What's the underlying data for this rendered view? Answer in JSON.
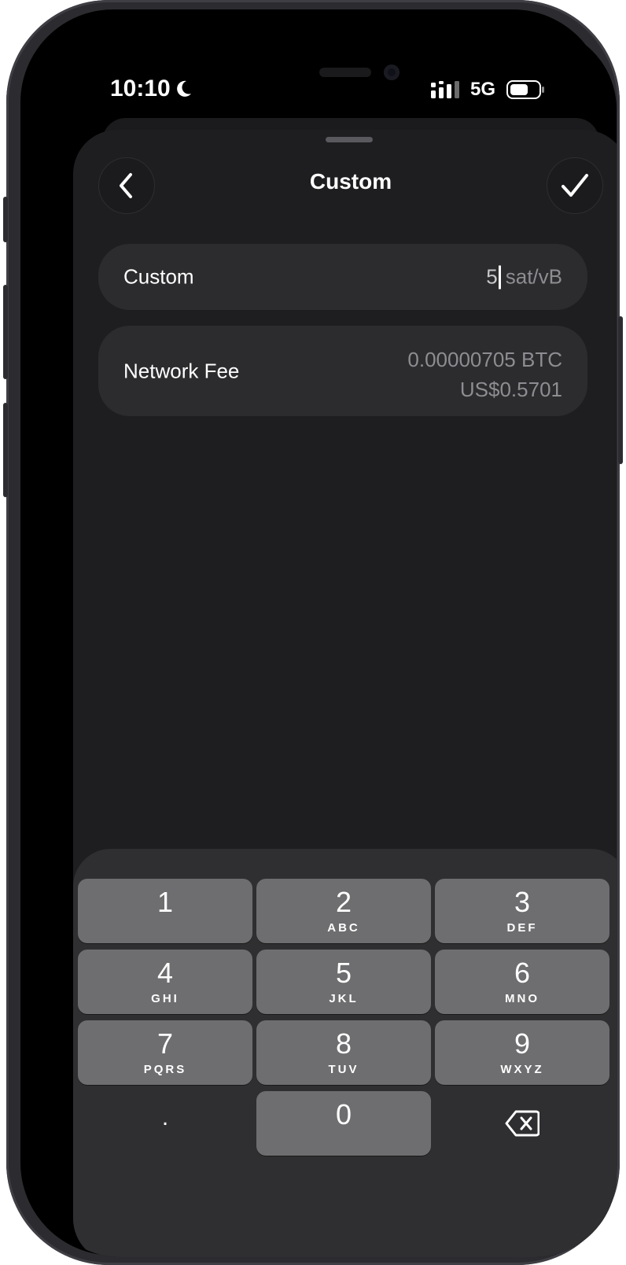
{
  "status": {
    "time": "10:10",
    "network": "5G"
  },
  "header": {
    "title": "Custom"
  },
  "custom_row": {
    "label": "Custom",
    "value": "5",
    "unit": "sat/vB"
  },
  "fee_row": {
    "label": "Network Fee",
    "btc": "0.00000705 BTC",
    "usd": "US$0.5701"
  },
  "keypad": {
    "keys": [
      {
        "digit": "1",
        "letters": ""
      },
      {
        "digit": "2",
        "letters": "ABC"
      },
      {
        "digit": "3",
        "letters": "DEF"
      },
      {
        "digit": "4",
        "letters": "GHI"
      },
      {
        "digit": "5",
        "letters": "JKL"
      },
      {
        "digit": "6",
        "letters": "MNO"
      },
      {
        "digit": "7",
        "letters": "PQRS"
      },
      {
        "digit": "8",
        "letters": "TUV"
      },
      {
        "digit": "9",
        "letters": "WXYZ"
      }
    ],
    "decimal": ".",
    "zero": "0"
  },
  "icons": {
    "back": "chevron-left-icon",
    "confirm": "checkmark-icon",
    "delete": "backspace-icon",
    "dnd": "moon-icon",
    "signal": "signal-icon",
    "battery": "battery-icon"
  },
  "colors": {
    "sheet": "#1e1e20",
    "row": "#2c2c2e",
    "key": "#6e6e70",
    "keyboard": "#2f2f31"
  }
}
